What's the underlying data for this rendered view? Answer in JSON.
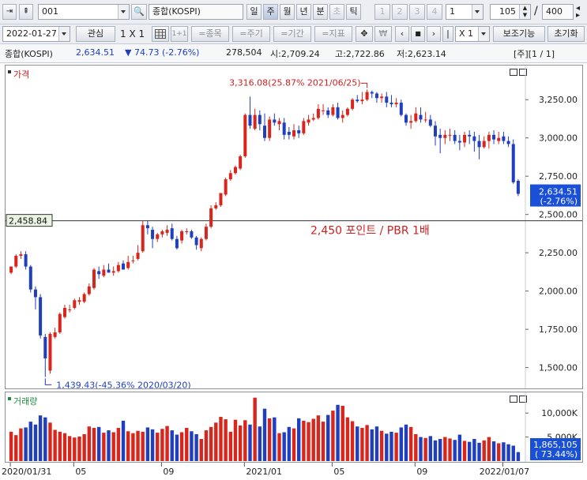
{
  "toolbar1": {
    "code_value": "001",
    "index_name": "종합(KOSPI)",
    "periods": [
      "일",
      "주",
      "월",
      "년",
      "분",
      "초",
      "틱"
    ],
    "active_period": "주",
    "num_buttons": [
      "1",
      "2",
      "3",
      "4"
    ],
    "interval_value": "1",
    "count_value": "105",
    "count_total": "400",
    "slash": "/"
  },
  "toolbar2": {
    "date_value": "2022-01-27",
    "interest_label": "관심",
    "layout_label": "1 X 1",
    "overlay_label": "1+1",
    "item_label": "=종목",
    "period_label": "=주기",
    "range_label": "=기간",
    "indicator_label": "=지표",
    "won_label": "₩",
    "multiplier_value": "X 1",
    "aux_label": "보조기능",
    "reset_label": "초기화"
  },
  "infobar": {
    "name": "종합(KOSPI)",
    "price": "2,634.51",
    "change": "▼ 74.73 (-2.76%)",
    "volume": "278,504",
    "open": "시:2,709.24",
    "high": "고:2,722.86",
    "low": "저:2,623.14",
    "page": "[주][1 / 1]"
  },
  "price_panel": {
    "title": "가격",
    "y_ticks": [
      "3,250.00",
      "3,000.00",
      "2,750.00",
      "2,500.00",
      "2,250.00",
      "2,000.00",
      "1,750.00",
      "1,500.00"
    ],
    "h_line_label": "2,458.84",
    "annotation": "2,450 포인트 / PBR 1배",
    "high_label": "3,316.08(25.87% 2021/06/25)",
    "low_label": "1,439.43(-45.36% 2020/03/20)",
    "last_price": "2,634.51",
    "last_change": "(-2.76%)"
  },
  "volume_panel": {
    "title": "거래량",
    "y_ticks": [
      "10,000K",
      "5,000K"
    ],
    "last_volume": "1,865,105",
    "last_ratio": "( 73.44%)"
  },
  "x_axis_labels": [
    "2020/01/31",
    "05",
    "09",
    "2021/01",
    "05",
    "09",
    "2022/01/07"
  ],
  "colors": {
    "up": "#d8261c",
    "down": "#1f3fbf",
    "highlight": "#1a4fd8",
    "annotation": "#d22020"
  },
  "chart_data": {
    "type": "candlestick",
    "x": [
      "2020/01/31",
      "2020/02/07",
      "2020/02/14",
      "2020/02/21",
      "2020/02/28",
      "2020/03/06",
      "2020/03/13",
      "2020/03/20",
      "2020/03/27",
      "2020/04/03",
      "2020/04/10",
      "2020/04/17",
      "2020/04/24",
      "2020/05/01",
      "2020/05/08",
      "2020/05/15",
      "2020/05/22",
      "2020/05/29",
      "2020/06/05",
      "2020/06/12",
      "2020/06/19",
      "2020/06/26",
      "2020/07/03",
      "2020/07/10",
      "2020/07/17",
      "2020/07/24",
      "2020/07/31",
      "2020/08/07",
      "2020/08/14",
      "2020/08/21",
      "2020/08/28",
      "2020/09/04",
      "2020/09/11",
      "2020/09/18",
      "2020/09/25",
      "2020/10/02",
      "2020/10/09",
      "2020/10/16",
      "2020/10/23",
      "2020/10/30",
      "2020/11/06",
      "2020/11/13",
      "2020/11/20",
      "2020/11/27",
      "2020/12/04",
      "2020/12/11",
      "2020/12/18",
      "2020/12/25",
      "2021/01/01",
      "2021/01/08",
      "2021/01/15",
      "2021/01/22",
      "2021/01/29",
      "2021/02/05",
      "2021/02/12",
      "2021/02/19",
      "2021/02/26",
      "2021/03/05",
      "2021/03/12",
      "2021/03/19",
      "2021/03/26",
      "2021/04/02",
      "2021/04/09",
      "2021/04/16",
      "2021/04/23",
      "2021/04/30",
      "2021/05/07",
      "2021/05/14",
      "2021/05/21",
      "2021/05/28",
      "2021/06/04",
      "2021/06/11",
      "2021/06/18",
      "2021/06/25",
      "2021/07/02",
      "2021/07/09",
      "2021/07/16",
      "2021/07/23",
      "2021/07/30",
      "2021/08/06",
      "2021/08/13",
      "2021/08/20",
      "2021/08/27",
      "2021/09/03",
      "2021/09/10",
      "2021/09/17",
      "2021/09/24",
      "2021/10/01",
      "2021/10/08",
      "2021/10/15",
      "2021/10/22",
      "2021/10/29",
      "2021/11/05",
      "2021/11/12",
      "2021/11/19",
      "2021/11/26",
      "2021/12/03",
      "2021/12/10",
      "2021/12/17",
      "2021/12/24",
      "2021/12/31",
      "2022/01/07",
      "2022/01/14",
      "2022/01/21",
      "2022/01/27"
    ],
    "open": [
      2120,
      2160,
      2230,
      2240,
      2160,
      2010,
      1960,
      1700,
      1480,
      1700,
      1730,
      1830,
      1880,
      1890,
      1930,
      1930,
      1980,
      2020,
      2130,
      2100,
      2140,
      2120,
      2130,
      2180,
      2150,
      2200,
      2210,
      2260,
      2430,
      2400,
      2340,
      2370,
      2380,
      2410,
      2340,
      2330,
      2390,
      2390,
      2350,
      2280,
      2340,
      2420,
      2540,
      2560,
      2630,
      2730,
      2770,
      2800,
      2880,
      3150,
      3060,
      3150,
      3080,
      3000,
      3120,
      3090,
      3100,
      3040,
      3010,
      3050,
      3030,
      3100,
      3120,
      3130,
      3180,
      3180,
      3150,
      3200,
      3130,
      3150,
      3190,
      3250,
      3240,
      3250,
      3300,
      3290,
      3260,
      3270,
      3230,
      3220,
      3230,
      3150,
      3100,
      3110,
      3150,
      3120,
      3120,
      3080,
      3020,
      3000,
      3020,
      3020,
      2980,
      2970,
      3020,
      3010,
      2980,
      2940,
      2980,
      3020,
      2980,
      3010,
      2980,
      2960,
      2720
    ],
    "high": [
      2160,
      2240,
      2260,
      2260,
      2170,
      2030,
      1980,
      1720,
      1730,
      1760,
      1860,
      1910,
      1910,
      1950,
      1960,
      1990,
      2050,
      2150,
      2160,
      2170,
      2180,
      2160,
      2190,
      2200,
      2230,
      2230,
      2300,
      2460,
      2460,
      2420,
      2380,
      2400,
      2430,
      2440,
      2360,
      2400,
      2410,
      2400,
      2360,
      2350,
      2440,
      2560,
      2580,
      2640,
      2740,
      2790,
      2820,
      2890,
      3160,
      3270,
      3190,
      3180,
      3160,
      3140,
      3160,
      3130,
      3130,
      3070,
      3090,
      3080,
      3130,
      3150,
      3160,
      3220,
      3220,
      3200,
      3220,
      3230,
      3180,
      3200,
      3260,
      3280,
      3300,
      3316,
      3310,
      3300,
      3290,
      3300,
      3280,
      3260,
      3250,
      3160,
      3150,
      3200,
      3200,
      3170,
      3150,
      3110,
      3060,
      3050,
      3060,
      3050,
      3020,
      3040,
      3050,
      3040,
      3020,
      3010,
      3040,
      3050,
      3040,
      3040,
      3010,
      2990,
      2730
    ],
    "low": [
      2110,
      2150,
      2210,
      2140,
      1990,
      1880,
      1690,
      1439,
      1460,
      1690,
      1720,
      1820,
      1860,
      1880,
      1910,
      1920,
      1970,
      2010,
      2080,
      2090,
      2120,
      2100,
      2120,
      2140,
      2140,
      2180,
      2200,
      2250,
      2370,
      2280,
      2320,
      2350,
      2360,
      2330,
      2270,
      2310,
      2370,
      2340,
      2270,
      2260,
      2330,
      2410,
      2530,
      2550,
      2620,
      2720,
      2760,
      2790,
      2870,
      3060,
      3050,
      3050,
      2980,
      2980,
      3080,
      3050,
      2990,
      2990,
      2990,
      3000,
      3020,
      3080,
      3110,
      3120,
      3150,
      3130,
      3140,
      3120,
      3100,
      3140,
      3180,
      3230,
      3220,
      3240,
      3260,
      3230,
      3230,
      3200,
      3200,
      3200,
      3140,
      3080,
      3060,
      3100,
      3100,
      3100,
      3070,
      2950,
      2900,
      2960,
      2980,
      2960,
      2920,
      2940,
      2960,
      2910,
      2860,
      2930,
      2930,
      2960,
      2960,
      2960,
      2940,
      2700,
      2620
    ],
    "close": [
      2160,
      2230,
      2240,
      2160,
      2010,
      1960,
      1710,
      1560,
      1720,
      1730,
      1850,
      1890,
      1880,
      1940,
      1940,
      1980,
      2030,
      2140,
      2110,
      2140,
      2120,
      2130,
      2170,
      2140,
      2190,
      2200,
      2250,
      2430,
      2410,
      2340,
      2370,
      2390,
      2400,
      2340,
      2280,
      2390,
      2390,
      2350,
      2300,
      2340,
      2420,
      2540,
      2560,
      2640,
      2730,
      2770,
      2810,
      2880,
      3150,
      3080,
      3150,
      3090,
      3000,
      3120,
      3100,
      3110,
      3020,
      3020,
      3050,
      3030,
      3110,
      3120,
      3130,
      3190,
      3180,
      3150,
      3200,
      3130,
      3150,
      3190,
      3250,
      3240,
      3250,
      3300,
      3290,
      3260,
      3270,
      3230,
      3220,
      3230,
      3150,
      3100,
      3110,
      3160,
      3120,
      3120,
      3080,
      3010,
      3000,
      3020,
      3020,
      2980,
      2970,
      3020,
      3010,
      2980,
      2940,
      2980,
      3020,
      2990,
      3000,
      2980,
      2960,
      2710,
      2634.51
    ],
    "volume": [
      6.1,
      5.4,
      6.8,
      7.0,
      8.2,
      7.6,
      9.5,
      9.1,
      8.0,
      6.5,
      6.1,
      5.8,
      5.2,
      4.9,
      5.1,
      5.6,
      7.2,
      6.9,
      7.1,
      5.9,
      6.4,
      6.0,
      6.9,
      8.4,
      6.2,
      5.8,
      6.3,
      6.1,
      7.0,
      6.6,
      5.9,
      6.7,
      7.3,
      6.4,
      5.5,
      6.0,
      6.9,
      6.2,
      5.6,
      4.6,
      6.4,
      7.1,
      8.0,
      9.2,
      8.7,
      6.1,
      8.6,
      7.4,
      8.5,
      7.6,
      13.2,
      7.2,
      10.9,
      8.9,
      9.1,
      5.8,
      6.0,
      7.1,
      6.8,
      8.9,
      8.4,
      8.1,
      8.8,
      9.5,
      8.2,
      9.6,
      10.5,
      11.7,
      11.5,
      9.1,
      8.3,
      7.2,
      6.9,
      7.5,
      6.6,
      7.2,
      6.3,
      5.7,
      6.1,
      5.9,
      7.0,
      7.6,
      7.1,
      5.6,
      5.0,
      4.8,
      5.2,
      4.3,
      4.6,
      5.0,
      4.7,
      4.4,
      5.5,
      4.2,
      4.0,
      4.6,
      3.8,
      4.3,
      5.0,
      4.1,
      3.7,
      3.9,
      3.5,
      3.2,
      1.87
    ],
    "volume_unit": "K (thousands), in millions",
    "y_range": [
      1400,
      3380
    ],
    "volume_range": [
      0,
      12000
    ],
    "horizontal_line": 2458.84
  }
}
